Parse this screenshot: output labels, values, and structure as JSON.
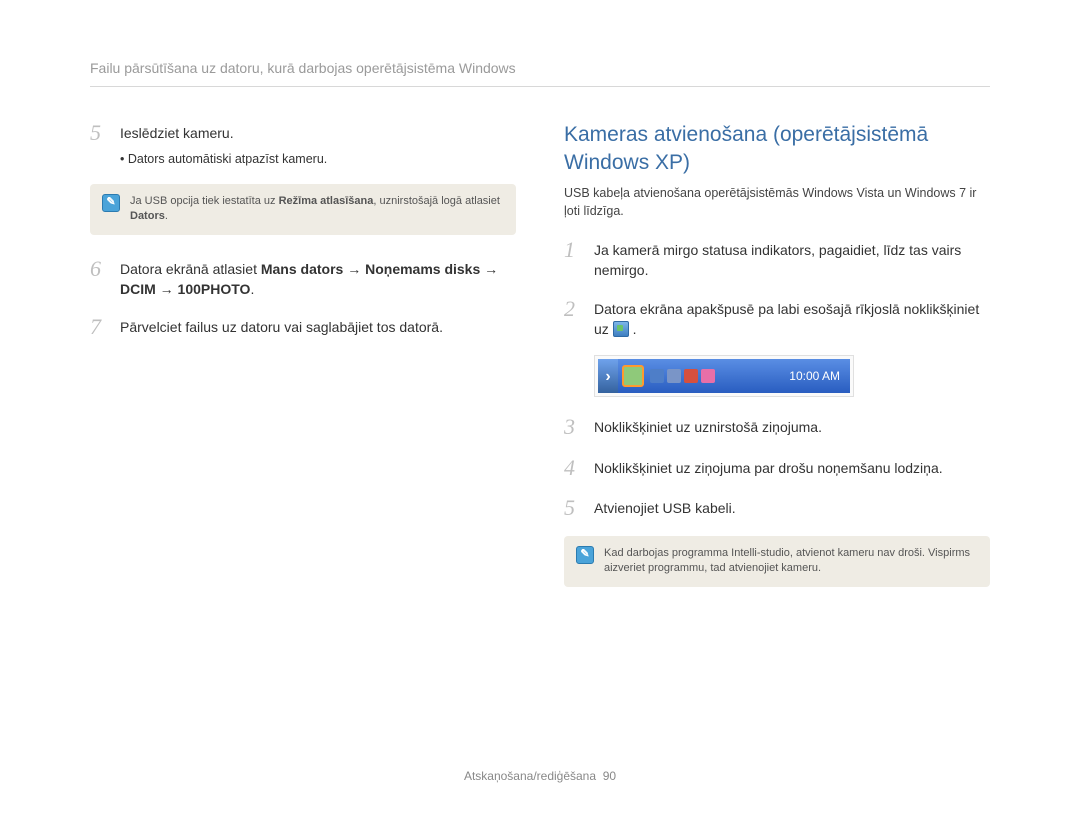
{
  "header": {
    "title": "Failu pārsūtīšana uz datoru, kurā darbojas operētājsistēma Windows"
  },
  "left": {
    "step5": {
      "num": "5",
      "text": "Ieslēdziet kameru.",
      "sub": "Dators automātiski atpazīst kameru."
    },
    "note1": {
      "prefix": "Ja USB opcija tiek iestatīta uz ",
      "bold1": "Režīma atlasīšana",
      "mid": ", uznirstošajā logā atlasiet ",
      "bold2": "Dators",
      "suffix": "."
    },
    "step6": {
      "num": "6",
      "prefix": "Datora ekrānā atlasiet ",
      "bold": "Mans dators → Noņemams disks → DCIM → 100PHOTO",
      "suffix": "."
    },
    "step7": {
      "num": "7",
      "text": "Pārvelciet failus uz datoru vai saglabājiet tos datorā."
    }
  },
  "right": {
    "title": "Kameras atvienošana (operētājsistēmā Windows XP)",
    "sub": "USB kabeļa atvienošana operētājsistēmās Windows Vista un Windows 7 ir ļoti līdzīga.",
    "step1": {
      "num": "1",
      "text": "Ja kamerā mirgo statusa indikators, pagaidiet, līdz tas vairs nemirgo."
    },
    "step2": {
      "num": "2",
      "prefix": "Datora ekrāna apakšpusē pa labi esošajā rīkjoslā noklikšķiniet uz ",
      "suffix": " ."
    },
    "taskbar": {
      "time": "10:00 AM"
    },
    "step3": {
      "num": "3",
      "text": "Noklikšķiniet uz uznirstošā ziņojuma."
    },
    "step4": {
      "num": "4",
      "text": "Noklikšķiniet uz ziņojuma par drošu noņemšanu lodziņa."
    },
    "step5": {
      "num": "5",
      "text": "Atvienojiet USB kabeli."
    },
    "note2": "Kad darbojas programma Intelli-studio, atvienot kameru nav droši. Vispirms aizveriet programmu, tad atvienojiet kameru."
  },
  "footer": {
    "section": "Atskaņošana/rediģēšana",
    "page": "90"
  }
}
